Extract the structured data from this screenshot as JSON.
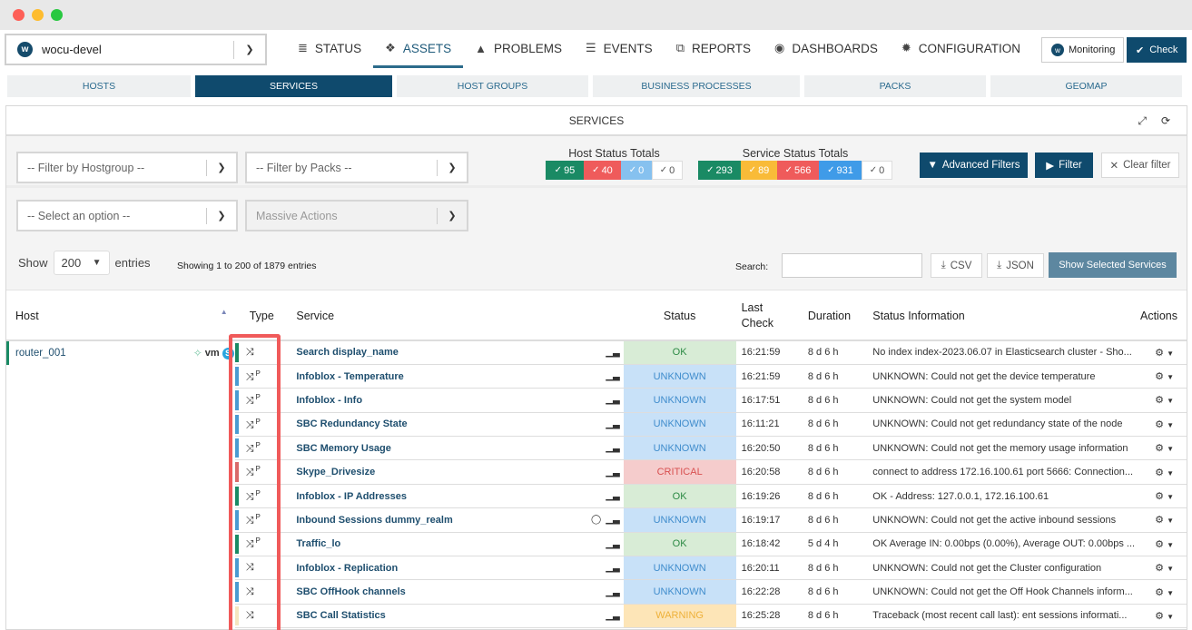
{
  "window": {
    "controls": [
      "close",
      "minimize",
      "maximize"
    ]
  },
  "site_selector": {
    "logo": "w",
    "value": "wocu-devel"
  },
  "nav": {
    "items": [
      {
        "label": "STATUS",
        "icon": "list-icon",
        "glyph": "≣",
        "active": false
      },
      {
        "label": "ASSETS",
        "icon": "cubes-icon",
        "glyph": "❖",
        "active": true
      },
      {
        "label": "PROBLEMS",
        "icon": "warning-icon",
        "glyph": "▲",
        "active": false
      },
      {
        "label": "EVENTS",
        "icon": "database-icon",
        "glyph": "☰",
        "active": false
      },
      {
        "label": "REPORTS",
        "icon": "copy-icon",
        "glyph": "⧉",
        "active": false
      },
      {
        "label": "DASHBOARDS",
        "icon": "dashboard-icon",
        "glyph": "◉",
        "active": false
      },
      {
        "label": "CONFIGURATION",
        "icon": "gear-icon",
        "glyph": "✹",
        "active": false
      }
    ],
    "monitoring_label": "Monitoring",
    "check_label": "Check"
  },
  "subtabs": [
    {
      "label": "HOSTS",
      "active": false
    },
    {
      "label": "SERVICES",
      "active": true
    },
    {
      "label": "HOST GROUPS",
      "active": false
    },
    {
      "label": "BUSINESS PROCESSES",
      "active": false
    },
    {
      "label": "PACKS",
      "active": false
    },
    {
      "label": "GEOMAP",
      "active": false
    }
  ],
  "panel": {
    "title": "SERVICES"
  },
  "filters": {
    "hostgroup_placeholder": "-- Filter by Hostgroup --",
    "packs_placeholder": "-- Filter by Packs --",
    "option_placeholder": "-- Select an option --",
    "massive_actions": "Massive Actions",
    "host_totals_title": "Host Status Totals",
    "host_totals": [
      {
        "value": "95",
        "state": "up",
        "color": "#1a8a64"
      },
      {
        "value": "40",
        "state": "down",
        "color": "#ef5b5b"
      },
      {
        "value": "0",
        "state": "unreachable",
        "color": "#86c1ef"
      },
      {
        "value": "0",
        "state": "pending",
        "color": "#ffffff"
      }
    ],
    "service_totals_title": "Service Status Totals",
    "service_totals": [
      {
        "value": "293",
        "state": "ok",
        "color": "#1a8a64"
      },
      {
        "value": "89",
        "state": "warning",
        "color": "#f9bb38"
      },
      {
        "value": "566",
        "state": "critical",
        "color": "#ef5b5b"
      },
      {
        "value": "931",
        "state": "unknown",
        "color": "#3f9be8"
      },
      {
        "value": "0",
        "state": "pending",
        "color": "#ffffff"
      }
    ],
    "advanced_label": "Advanced Filters",
    "filter_label": "Filter",
    "clear_label": "Clear filter"
  },
  "table_controls": {
    "show_label": "Show",
    "entries_value": "200",
    "entries_label": "entries",
    "showing_text": "Showing 1 to 200 of 1879 entries",
    "search_label": "Search:",
    "search_value": "",
    "csv_label": "CSV",
    "json_label": "JSON",
    "show_selected_label": "Show Selected Services"
  },
  "table": {
    "headers": {
      "host": "Host",
      "type": "Type",
      "service": "Service",
      "status": "Status",
      "last_check": "Last Check",
      "duration": "Duration",
      "info": "Status Information",
      "actions": "Actions"
    },
    "host": {
      "name": "router_001",
      "icons": [
        "cluster-icon",
        "vmware-icon",
        "skype-icon"
      ],
      "vm_text": "vm",
      "skype_text": "S"
    },
    "rows": [
      {
        "passive": false,
        "service": "Search display_name",
        "comment": false,
        "status": "OK",
        "last_check": "16:21:59",
        "duration": "8 d 6 h",
        "info": "No index index-2023.06.07 in Elasticsearch cluster - Sho..."
      },
      {
        "passive": true,
        "service": "Infoblox - Temperature",
        "comment": false,
        "status": "UNKNOWN",
        "last_check": "16:21:59",
        "duration": "8 d 6 h",
        "info": "UNKNOWN: Could not get the device temperature"
      },
      {
        "passive": true,
        "service": "Infoblox - Info",
        "comment": false,
        "status": "UNKNOWN",
        "last_check": "16:17:51",
        "duration": "8 d 6 h",
        "info": "UNKNOWN: Could not get the system model"
      },
      {
        "passive": true,
        "service": "SBC Redundancy State",
        "comment": false,
        "status": "UNKNOWN",
        "last_check": "16:11:21",
        "duration": "8 d 6 h",
        "info": "UNKNOWN: Could not get redundancy state of the node"
      },
      {
        "passive": true,
        "service": "SBC Memory Usage",
        "comment": false,
        "status": "UNKNOWN",
        "last_check": "16:20:50",
        "duration": "8 d 6 h",
        "info": "UNKNOWN: Could not get the memory usage information"
      },
      {
        "passive": true,
        "service": "Skype_Drivesize",
        "comment": false,
        "status": "CRITICAL",
        "last_check": "16:20:58",
        "duration": "8 d 6 h",
        "info": "connect to address 172.16.100.61 port 5666: Connection..."
      },
      {
        "passive": true,
        "service": "Infoblox - IP Addresses",
        "comment": false,
        "status": "OK",
        "last_check": "16:19:26",
        "duration": "8 d 6 h",
        "info": "OK - Address: 127.0.0.1, 172.16.100.61"
      },
      {
        "passive": true,
        "service": "Inbound Sessions dummy_realm",
        "comment": true,
        "status": "UNKNOWN",
        "last_check": "16:19:17",
        "duration": "8 d 6 h",
        "info": "UNKNOWN: Could not get the active inbound sessions"
      },
      {
        "passive": true,
        "service": "Traffic_lo",
        "comment": false,
        "status": "OK",
        "last_check": "16:18:42",
        "duration": "5 d 4 h",
        "info": "OK Average IN: 0.00bps (0.00%), Average OUT: 0.00bps ..."
      },
      {
        "passive": false,
        "service": "Infoblox - Replication",
        "comment": false,
        "status": "UNKNOWN",
        "last_check": "16:20:11",
        "duration": "8 d 6 h",
        "info": "UNKNOWN: Could not get the Cluster configuration"
      },
      {
        "passive": false,
        "service": "SBC OffHook channels",
        "comment": false,
        "status": "UNKNOWN",
        "last_check": "16:22:28",
        "duration": "8 d 6 h",
        "info": "UNKNOWN: Could not get the Off Hook Channels inform..."
      },
      {
        "passive": false,
        "service": "SBC Call Statistics",
        "comment": false,
        "status": "WARNING",
        "last_check": "16:25:28",
        "duration": "8 d 6 h",
        "info": "Traceback (most recent call last):     ent sessions informati..."
      }
    ],
    "status_colors": {
      "OK": "#1a8a64",
      "UNKNOWN": "#4a9bd1",
      "CRITICAL": "#d96a6a",
      "WARNING": "#f5e6c0"
    },
    "passive_marker": "P"
  },
  "highlight": {
    "color": "#f05a5a",
    "target": "type-column"
  }
}
